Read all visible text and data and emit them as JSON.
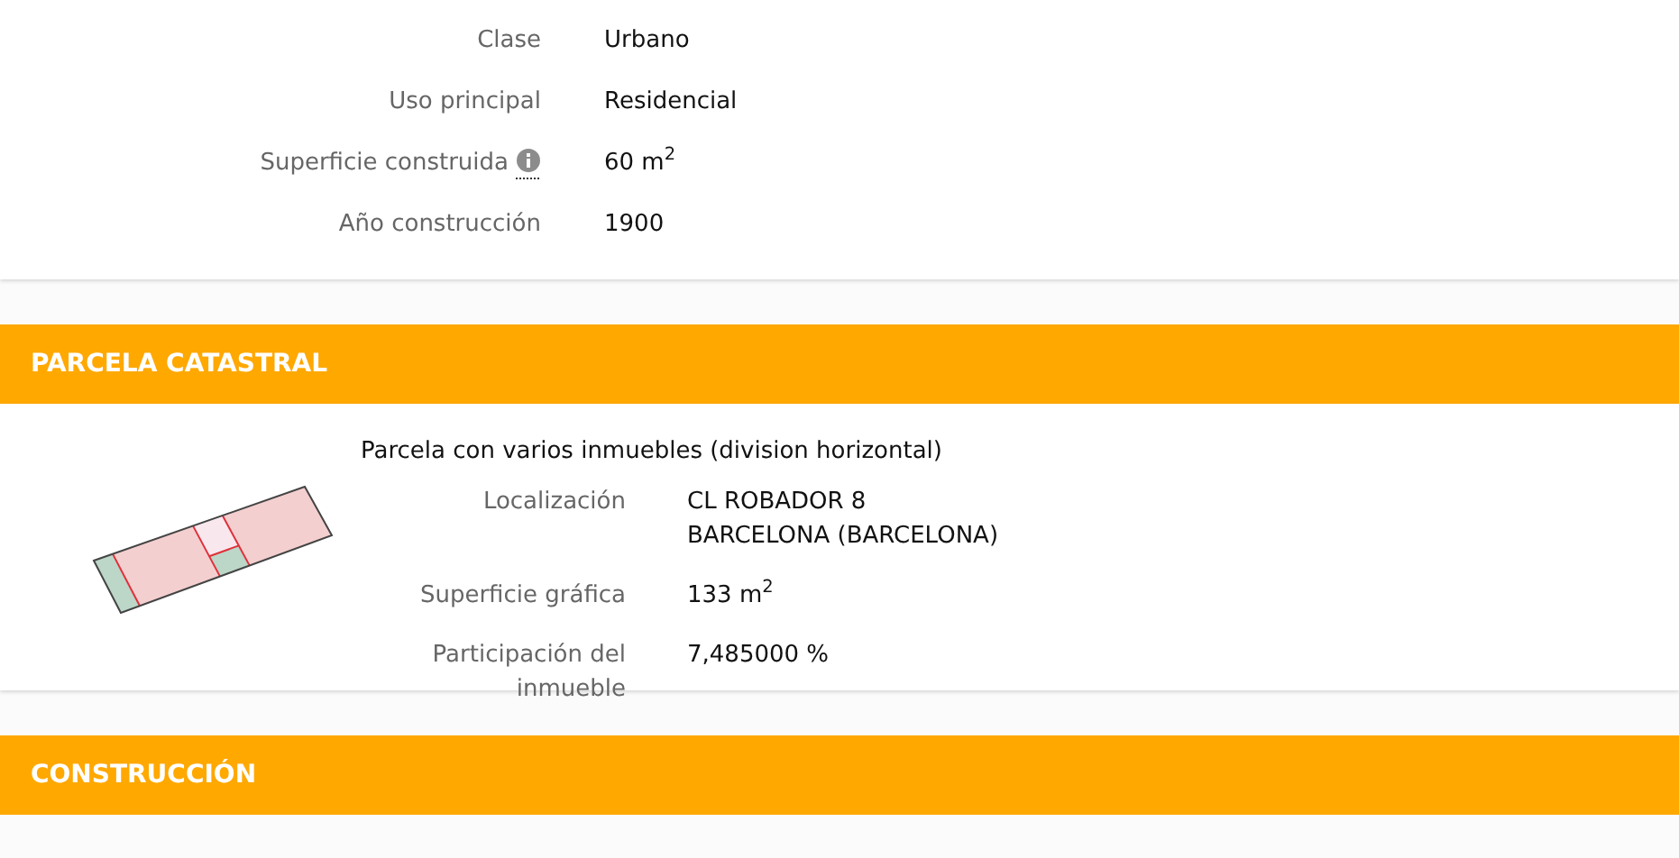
{
  "building": {
    "rows": [
      {
        "kind": "plain",
        "label": "Clase",
        "value": "Urbano"
      },
      {
        "kind": "plain",
        "label": "Uso principal",
        "value": "Residencial"
      },
      {
        "kind": "info",
        "label": "Superficie construida",
        "value": "60 m$^{2}$"
      },
      {
        "kind": "plain",
        "label": "Año construcción",
        "value": "1900"
      }
    ]
  },
  "parcel": {
    "title": "PARCELA CATASTRAL",
    "description": "Parcela con varios inmuebles (division horizontal)",
    "rows": [
      {
        "label": "Localización",
        "lines": [
          "CL ROBADOR 8",
          "BARCELONA (BARCELONA)"
        ]
      },
      {
        "label": "Superficie gráfica",
        "lines": [
          "133 m$^{2}$"
        ]
      },
      {
        "label": "Participación del inmueble",
        "lines": [
          "7,485000 %"
        ]
      }
    ]
  },
  "construction": {
    "title": "CONSTRUCCIÓN"
  }
}
